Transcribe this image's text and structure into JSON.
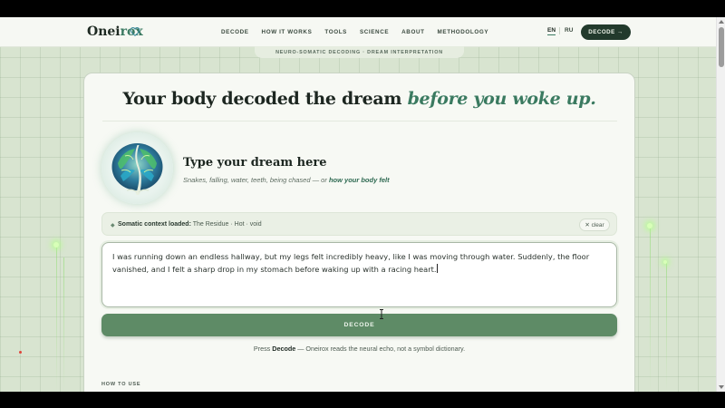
{
  "header": {
    "brand_prefix": "Onei",
    "brand_accent": "rox",
    "nav": [
      "DECODE",
      "HOW IT WORKS",
      "TOOLS",
      "SCIENCE",
      "ABOUT",
      "METHODOLOGY"
    ],
    "lang_en": "EN",
    "lang_ru": "RU",
    "cta": "DECODE →"
  },
  "badge": "NEURO-SOMATIC DECODING · DREAM INTERPRETATION",
  "hero": {
    "headline_plain": "Your body decoded the dream ",
    "headline_emphasis": "before you woke up."
  },
  "prompt": {
    "title": "Type your dream here",
    "subtitle_plain": "Snakes, falling, water, teeth, being chased — or ",
    "subtitle_bold": "how your body felt"
  },
  "context": {
    "label": "Somatic context loaded:",
    "value": " The Residue · Hot · void",
    "clear": "✕ clear"
  },
  "dream_input": {
    "value": "I was running down an endless hallway, but my legs felt incredibly heavy, like I was moving through water. Suddenly, the floor vanished, and I felt a sharp drop in my stomach before waking up with a racing heart."
  },
  "decode_button": "DECODE",
  "helper": {
    "prefix": "Press ",
    "bold": "Decode",
    "suffix": " — Oneirox reads the neural echo, not a symbol dictionary."
  },
  "how_to_use": "HOW TO USE",
  "colors": {
    "accent": "#3b7a62",
    "decode_button": "#5e8b66",
    "header_cta": "#223a2c",
    "page_background": "#d8e4d0"
  },
  "icons": [
    "heart-icon",
    "brain-tree-icon",
    "diamond-icon",
    "text-cursor-icon"
  ]
}
